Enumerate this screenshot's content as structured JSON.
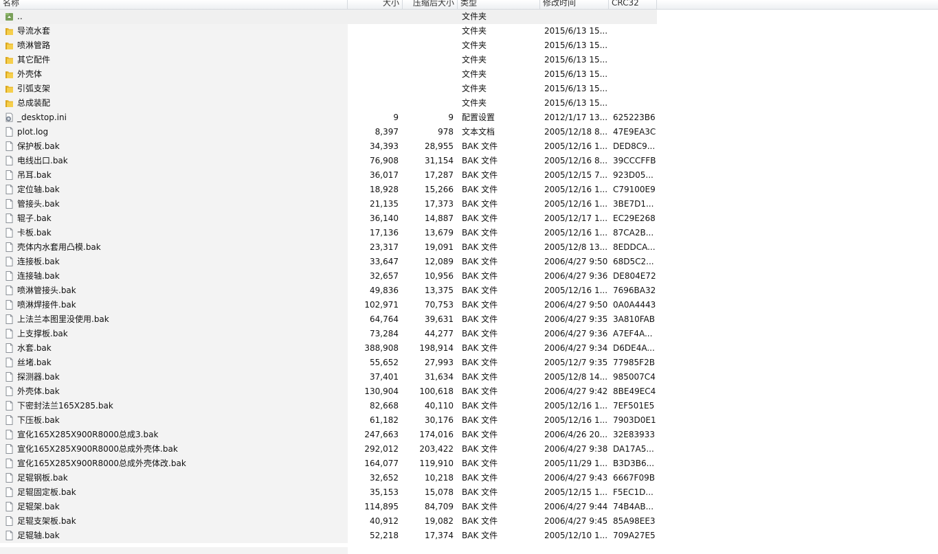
{
  "columns": {
    "name": "名称",
    "size": "大小",
    "packed": "压缩后大小",
    "type": "类型",
    "modified": "修改时间",
    "crc": "CRC32"
  },
  "icons": {
    "folder_up": "folder-up-icon",
    "folder": "folder-icon",
    "config": "config-file-icon",
    "file": "file-icon"
  },
  "rows": [
    {
      "icon": "folder_up",
      "name": "..",
      "size": "",
      "packed": "",
      "type": "文件夹",
      "modified": "",
      "crc": ""
    },
    {
      "icon": "folder",
      "name": "导流水套",
      "size": "",
      "packed": "",
      "type": "文件夹",
      "modified": "2015/6/13 15...",
      "crc": ""
    },
    {
      "icon": "folder",
      "name": "喷淋管路",
      "size": "",
      "packed": "",
      "type": "文件夹",
      "modified": "2015/6/13 15...",
      "crc": ""
    },
    {
      "icon": "folder",
      "name": "其它配件",
      "size": "",
      "packed": "",
      "type": "文件夹",
      "modified": "2015/6/13 15...",
      "crc": ""
    },
    {
      "icon": "folder",
      "name": "外壳体",
      "size": "",
      "packed": "",
      "type": "文件夹",
      "modified": "2015/6/13 15...",
      "crc": ""
    },
    {
      "icon": "folder",
      "name": "引弧支架",
      "size": "",
      "packed": "",
      "type": "文件夹",
      "modified": "2015/6/13 15...",
      "crc": ""
    },
    {
      "icon": "folder",
      "name": "总成装配",
      "size": "",
      "packed": "",
      "type": "文件夹",
      "modified": "2015/6/13 15...",
      "crc": ""
    },
    {
      "icon": "config",
      "name": "_desktop.ini",
      "size": "9",
      "packed": "9",
      "type": "配置设置",
      "modified": "2012/1/17 13...",
      "crc": "625223B6"
    },
    {
      "icon": "file",
      "name": "plot.log",
      "size": "8,397",
      "packed": "978",
      "type": "文本文档",
      "modified": "2005/12/18 8...",
      "crc": "47E9EA3C"
    },
    {
      "icon": "file",
      "name": "保护板.bak",
      "size": "34,393",
      "packed": "28,955",
      "type": "BAK 文件",
      "modified": "2005/12/16 1...",
      "crc": "DED8C9..."
    },
    {
      "icon": "file",
      "name": "电线出口.bak",
      "size": "76,908",
      "packed": "31,154",
      "type": "BAK 文件",
      "modified": "2005/12/16 8...",
      "crc": "39CCCFFB"
    },
    {
      "icon": "file",
      "name": "吊耳.bak",
      "size": "36,017",
      "packed": "17,287",
      "type": "BAK 文件",
      "modified": "2005/12/15 7...",
      "crc": "923D05..."
    },
    {
      "icon": "file",
      "name": "定位轴.bak",
      "size": "18,928",
      "packed": "15,266",
      "type": "BAK 文件",
      "modified": "2005/12/16 1...",
      "crc": "C79100E9"
    },
    {
      "icon": "file",
      "name": "管接头.bak",
      "size": "21,135",
      "packed": "17,373",
      "type": "BAK 文件",
      "modified": "2005/12/16 1...",
      "crc": "3BE7D1..."
    },
    {
      "icon": "file",
      "name": "辊子.bak",
      "size": "36,140",
      "packed": "14,887",
      "type": "BAK 文件",
      "modified": "2005/12/17 1...",
      "crc": "EC29E268"
    },
    {
      "icon": "file",
      "name": "卡板.bak",
      "size": "17,136",
      "packed": "13,679",
      "type": "BAK 文件",
      "modified": "2005/12/16 1...",
      "crc": "87CA2B..."
    },
    {
      "icon": "file",
      "name": "壳体内水套用凸模.bak",
      "size": "23,317",
      "packed": "19,091",
      "type": "BAK 文件",
      "modified": "2005/12/8 13...",
      "crc": "8EDDCA..."
    },
    {
      "icon": "file",
      "name": "连接板.bak",
      "size": "33,647",
      "packed": "12,089",
      "type": "BAK 文件",
      "modified": "2006/4/27 9:50",
      "crc": "68D5C2..."
    },
    {
      "icon": "file",
      "name": "连接轴.bak",
      "size": "32,657",
      "packed": "10,956",
      "type": "BAK 文件",
      "modified": "2006/4/27 9:36",
      "crc": "DE804E72"
    },
    {
      "icon": "file",
      "name": "喷淋管接头.bak",
      "size": "49,836",
      "packed": "13,375",
      "type": "BAK 文件",
      "modified": "2005/12/16 1...",
      "crc": "7696BA32"
    },
    {
      "icon": "file",
      "name": "喷淋焊接件.bak",
      "size": "102,971",
      "packed": "70,753",
      "type": "BAK 文件",
      "modified": "2006/4/27 9:50",
      "crc": "0A0A4443"
    },
    {
      "icon": "file",
      "name": "上法兰本图里没使用.bak",
      "size": "64,764",
      "packed": "39,631",
      "type": "BAK 文件",
      "modified": "2006/4/27 9:35",
      "crc": "3A810FAB"
    },
    {
      "icon": "file",
      "name": "上支撑板.bak",
      "size": "73,284",
      "packed": "44,277",
      "type": "BAK 文件",
      "modified": "2006/4/27 9:36",
      "crc": "A7EF4A..."
    },
    {
      "icon": "file",
      "name": "水套.bak",
      "size": "388,908",
      "packed": "198,914",
      "type": "BAK 文件",
      "modified": "2006/4/27 9:34",
      "crc": "D6DE4A..."
    },
    {
      "icon": "file",
      "name": "丝堵.bak",
      "size": "55,652",
      "packed": "27,993",
      "type": "BAK 文件",
      "modified": "2005/12/7 9:35",
      "crc": "77985F2B"
    },
    {
      "icon": "file",
      "name": "探测器.bak",
      "size": "37,401",
      "packed": "31,634",
      "type": "BAK 文件",
      "modified": "2005/12/8 14...",
      "crc": "985007C4"
    },
    {
      "icon": "file",
      "name": "外壳体.bak",
      "size": "130,904",
      "packed": "100,618",
      "type": "BAK 文件",
      "modified": "2006/4/27 9:42",
      "crc": "8BE49EC4"
    },
    {
      "icon": "file",
      "name": "下密封法兰165X285.bak",
      "size": "82,668",
      "packed": "40,110",
      "type": "BAK 文件",
      "modified": "2005/12/16 1...",
      "crc": "7EF501E5"
    },
    {
      "icon": "file",
      "name": "下压板.bak",
      "size": "61,182",
      "packed": "30,176",
      "type": "BAK 文件",
      "modified": "2005/12/16 1...",
      "crc": "7903D0E1"
    },
    {
      "icon": "file",
      "name": "宣化165X285X900R8000总成3.bak",
      "size": "247,663",
      "packed": "174,016",
      "type": "BAK 文件",
      "modified": "2006/4/26 20...",
      "crc": "32E83933"
    },
    {
      "icon": "file",
      "name": "宣化165X285X900R8000总成外壳体.bak",
      "size": "292,012",
      "packed": "203,422",
      "type": "BAK 文件",
      "modified": "2006/4/27 9:38",
      "crc": "DA17A5..."
    },
    {
      "icon": "file",
      "name": "宣化165X285X900R8000总成外壳体改.bak",
      "size": "164,077",
      "packed": "119,910",
      "type": "BAK 文件",
      "modified": "2005/11/29 1...",
      "crc": "B3D3B6..."
    },
    {
      "icon": "file",
      "name": "足辊钢板.bak",
      "size": "32,652",
      "packed": "10,218",
      "type": "BAK 文件",
      "modified": "2006/4/27 9:43",
      "crc": "6667F09B"
    },
    {
      "icon": "file",
      "name": "足辊固定板.bak",
      "size": "35,153",
      "packed": "15,078",
      "type": "BAK 文件",
      "modified": "2005/12/15 1...",
      "crc": "F5EC1D..."
    },
    {
      "icon": "file",
      "name": "足辊架.bak",
      "size": "114,895",
      "packed": "84,709",
      "type": "BAK 文件",
      "modified": "2006/4/27 9:44",
      "crc": "74B4AB..."
    },
    {
      "icon": "file",
      "name": "足辊支架板.bak",
      "size": "40,912",
      "packed": "19,082",
      "type": "BAK 文件",
      "modified": "2006/4/27 9:45",
      "crc": "85A98EE3"
    },
    {
      "icon": "file",
      "name": "足辊轴.bak",
      "size": "52,218",
      "packed": "17,374",
      "type": "BAK 文件",
      "modified": "2005/12/10 1...",
      "crc": "709A27E5"
    }
  ]
}
